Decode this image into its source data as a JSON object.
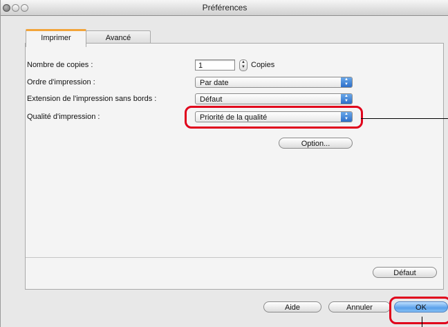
{
  "window": {
    "title": "Préférences"
  },
  "tabs": [
    {
      "label": "Imprimer",
      "active": true
    },
    {
      "label": "Avancé",
      "active": false
    }
  ],
  "form": {
    "copies": {
      "label": "Nombre de copies :",
      "value": "1",
      "suffix": "Copies"
    },
    "order": {
      "label": "Ordre d'impression :",
      "value": "Par date"
    },
    "extension": {
      "label": "Extension de l'impression sans bords :",
      "value": "Défaut"
    },
    "quality": {
      "label": "Qualité d'impression :",
      "value": "Priorité de la qualité"
    },
    "option_button": "Option..."
  },
  "panel_buttons": {
    "default_label": "Défaut"
  },
  "footer": {
    "help_label": "Aide",
    "cancel_label": "Annuler",
    "ok_label": "OK"
  },
  "colors": {
    "highlight": "#e0001b",
    "tab_accent": "#f2a43a",
    "default_button": "#5aa0ea"
  }
}
